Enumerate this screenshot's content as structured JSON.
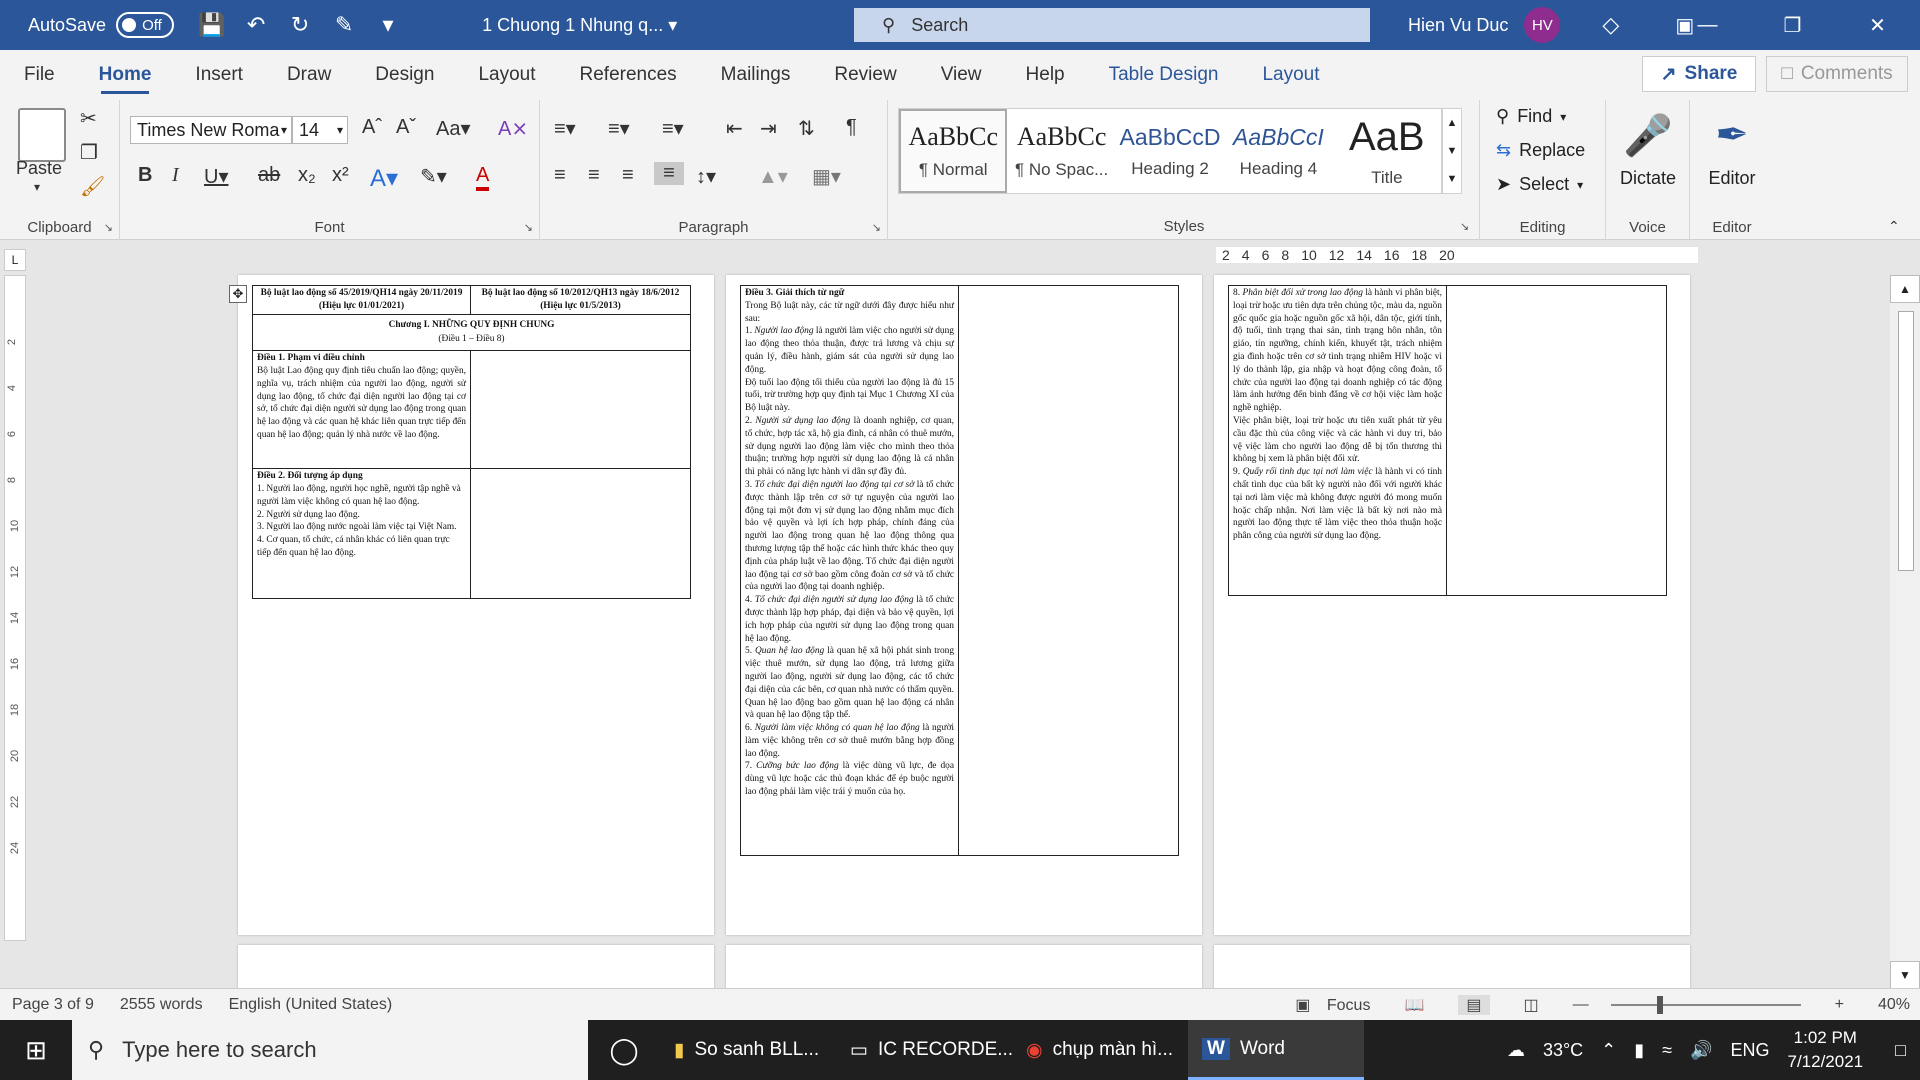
{
  "titlebar": {
    "autosave_label": "AutoSave",
    "autosave_state": "Off",
    "doc_title": "1 Chuong 1 Nhung q...",
    "search_placeholder": "Search",
    "user_name": "Hien Vu Duc",
    "user_initials": "HV"
  },
  "tabs": [
    "File",
    "Home",
    "Insert",
    "Draw",
    "Design",
    "Layout",
    "References",
    "Mailings",
    "Review",
    "View",
    "Help",
    "Table Design",
    "Layout"
  ],
  "share_label": "Share",
  "comments_label": "Comments",
  "ribbon": {
    "clipboard": {
      "label": "Clipboard",
      "paste": "Paste"
    },
    "font": {
      "label": "Font",
      "name": "Times New Roma",
      "size": "14"
    },
    "paragraph": {
      "label": "Paragraph"
    },
    "styles": {
      "label": "Styles",
      "items": [
        {
          "sample": "AaBbCc",
          "name": "¶ Normal"
        },
        {
          "sample": "AaBbCc",
          "name": "¶ No Spac..."
        },
        {
          "sample": "AaBbCcD",
          "name": "Heading 2"
        },
        {
          "sample": "AaBbCcI",
          "name": "Heading 4"
        },
        {
          "sample": "AaB",
          "name": "Title"
        }
      ]
    },
    "editing": {
      "label": "Editing",
      "find": "Find",
      "replace": "Replace",
      "select": "Select"
    },
    "voice": {
      "label": "Voice",
      "dictate": "Dictate"
    },
    "editor": {
      "label": "Editor",
      "editor": "Editor"
    }
  },
  "ruler": {
    "h_ticks": [
      "2",
      "4",
      "6",
      "8",
      "10",
      "12",
      "14",
      "16",
      "18",
      "20"
    ],
    "v_ticks": [
      "2",
      "4",
      "6",
      "8",
      "10",
      "12",
      "14",
      "16",
      "18",
      "20",
      "22",
      "24"
    ]
  },
  "doc": {
    "p1": {
      "h_left": "Bộ luật lao động số 45/2019/QH14 ngày 20/11/2019 (Hiệu lực 01/01/2021)",
      "h_right": "Bộ luật lao động số 10/2012/QH13 ngày 18/6/2012 (Hiệu lực 01/5/2013)",
      "chapter": "Chương I. NHỮNG QUY ĐỊNH CHUNG",
      "chapter_sub": "(Điều 1 – Điều 8)",
      "a1_title": "Điều 1. Phạm vi điều chỉnh",
      "a1_body": "Bộ luật Lao động quy định tiêu chuẩn lao động; quyền, nghĩa vụ, trách nhiệm của người lao động, người sử dụng lao động, tổ chức đại diện người lao động tại cơ sở, tổ chức đại diện người sử dụng lao động trong quan hệ lao động và các quan hệ khác liên quan trực tiếp đến quan hệ lao động; quản lý nhà nước về lao động.",
      "a2_title": "Điều 2. Đối tượng áp dụng",
      "a2_body": "1. Người lao động, người học nghề, người tập nghề và người làm việc không có quan hệ lao động.\n2. Người sử dụng lao động.\n3. Người lao động nước ngoài làm việc tại Việt Nam.\n4. Cơ quan, tổ chức, cá nhân khác có liên quan trực tiếp đến quan hệ lao động."
    },
    "p2": {
      "a3_title": "Điều 3. Giải thích từ ngữ",
      "a3_intro": "Trong Bộ luật này, các từ ngữ dưới đây được hiểu như sau:",
      "items": [
        {
          "num": "1. ",
          "term": "Người lao động",
          "text": " là người làm việc cho người sử dụng lao động theo thỏa thuận, được trả lương và chịu sự quản lý, điều hành, giám sát của người sử dụng lao động.\nĐộ tuổi lao động tối thiểu của người lao động là đủ 15 tuổi, trừ trường hợp quy định tại Mục 1 Chương XI của Bộ luật này."
        },
        {
          "num": "2. ",
          "term": "Người sử dụng lao động",
          "text": " là doanh nghiệp, cơ quan, tổ chức, hợp tác xã, hộ gia đình, cá nhân có thuê mướn, sử dụng người lao động làm việc cho mình theo thỏa thuận; trường hợp người sử dụng lao động là cá nhân thì phải có năng lực hành vi dân sự đầy đủ."
        },
        {
          "num": "3. ",
          "term": "Tổ chức đại diện người lao động tại cơ sở",
          "text": " là tổ chức được thành lập trên cơ sở tự nguyện của người lao động tại một đơn vị sử dụng lao động nhằm mục đích bảo vệ quyền và lợi ích hợp pháp, chính đáng của người lao động trong quan hệ lao động thông qua thương lượng tập thể hoặc các hình thức khác theo quy định của pháp luật về lao động. Tổ chức đại diện người lao động tại cơ sở bao gồm công đoàn cơ sở và tổ chức của người lao động tại doanh nghiệp."
        },
        {
          "num": "4. ",
          "term": "Tổ chức đại diện người sử dụng lao động",
          "text": " là tổ chức được thành lập hợp pháp, đại diện và bảo vệ quyền, lợi ích hợp pháp của người sử dụng lao động trong quan hệ lao động."
        },
        {
          "num": "5. ",
          "term": "Quan hệ lao động",
          "text": " là quan hệ xã hội phát sinh trong việc thuê mướn, sử dụng lao động, trả lương giữa người lao động, người sử dụng lao động, các tổ chức đại diện của các bên, cơ quan nhà nước có thẩm quyền. Quan hệ lao động bao gồm quan hệ lao động cá nhân và quan hệ lao động tập thể."
        },
        {
          "num": "6. ",
          "term": "Người làm việc không có quan hệ lao động",
          "text": " là người làm việc không trên cơ sở thuê mướn bằng hợp đồng lao động."
        },
        {
          "num": "7. ",
          "term": "Cưỡng bức lao động",
          "text": " là việc dùng vũ lực, đe dọa dùng vũ lực hoặc các thủ đoạn khác để ép buộc người lao động phải làm việc trái ý muốn của họ."
        }
      ]
    },
    "p3": {
      "items": [
        {
          "num": "8. ",
          "term": "Phân biệt đối xử trong lao động",
          "text": " là hành vi phân biệt, loại trừ hoặc ưu tiên dựa trên chủng tộc, màu da, nguồn gốc quốc gia hoặc nguồn gốc xã hội, dân tộc, giới tính, độ tuổi, tình trạng thai sản, tình trạng hôn nhân, tôn giáo, tín ngưỡng, chính kiến, khuyết tật, trách nhiệm gia đình hoặc trên cơ sở tình trạng nhiễm HIV hoặc vì lý do thành lập, gia nhập và hoạt động công đoàn, tổ chức của người lao động tại doanh nghiệp có tác động làm ảnh hưởng đến bình đẳng về cơ hội việc làm hoặc nghề nghiệp.\nViệc phân biệt, loại trừ hoặc ưu tiên xuất phát từ yêu cầu đặc thù của công việc và các hành vi duy trì, bảo vệ việc làm cho người lao động dễ bị tổn thương thì không bị xem là phân biệt đối xử."
        },
        {
          "num": "9. ",
          "term": "Quấy rối tình dục tại nơi làm việc",
          "text": " là hành vi có tính chất tình dục của bất kỳ người nào đối với người khác tại nơi làm việc mà không được người đó mong muốn hoặc chấp nhận. Nơi làm việc là bất kỳ nơi nào mà người lao động thực tế làm việc theo thỏa thuận hoặc phân công của người sử dụng lao động."
        }
      ]
    }
  },
  "status": {
    "page": "Page 3 of 9",
    "words": "2555 words",
    "language": "English (United States)",
    "focus": "Focus",
    "zoom": "40%"
  },
  "taskbar": {
    "search_placeholder": "Type here to search",
    "apps": [
      "So sanh BLL...",
      "IC RECORDE...",
      "chụp màn hì...",
      "Word"
    ],
    "weather": "33°C",
    "lang": "ENG",
    "time": "1:02 PM",
    "date": "7/12/2021"
  }
}
